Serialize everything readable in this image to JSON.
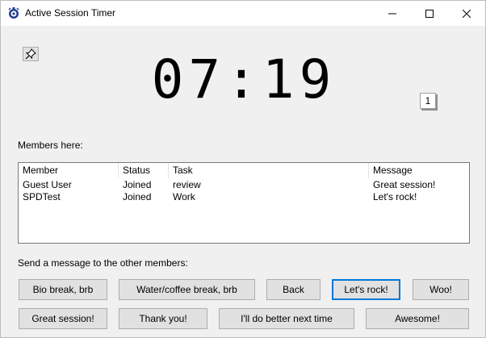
{
  "window": {
    "title": "Active Session Timer",
    "icon": "timer-app-icon",
    "controls": [
      "minimize-icon",
      "maximize-icon",
      "close-icon"
    ]
  },
  "timer": {
    "display": "07:19",
    "counter": "1",
    "pin_icon": "pin-icon"
  },
  "members": {
    "label": "Members here:",
    "columns": [
      "Member",
      "Status",
      "Task",
      "Message"
    ],
    "rows": [
      {
        "member": "Guest User",
        "status": "Joined",
        "task": "review",
        "message": "Great session!"
      },
      {
        "member": "SPDTest",
        "status": "Joined",
        "task": "Work",
        "message": "Let's rock!"
      }
    ]
  },
  "messages": {
    "label": "Send a message to the other members:",
    "buttons": [
      "Bio break, brb",
      "Water/coffee break, brb",
      "Back",
      "Let's rock!",
      "Woo!",
      "Great session!",
      "Thank you!",
      "I'll do better next time",
      "Awesome!"
    ],
    "focused_index": 3
  },
  "colors": {
    "window_bg": "#f0f0f0",
    "titlebar_bg": "#ffffff",
    "focus_border": "#0078d7"
  }
}
